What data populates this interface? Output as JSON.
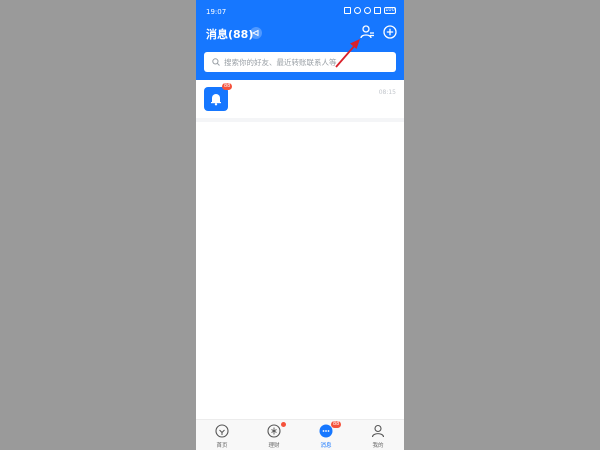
{
  "status_bar": {
    "time": "19:07",
    "battery": "100"
  },
  "header": {
    "title": "消息(88)"
  },
  "search": {
    "placeholder": "搜索你的好友、最近转账联系人等"
  },
  "messages": [
    {
      "badge": "88",
      "time": "08:15"
    }
  ],
  "tabbar": {
    "tabs": [
      {
        "label": "首页"
      },
      {
        "label": "理财"
      },
      {
        "label": "消息",
        "badge": "88"
      },
      {
        "label": "我的"
      }
    ]
  },
  "colors": {
    "brand": "#1677ff",
    "badge": "#f5523c",
    "annotation_arrow": "#d9202a"
  }
}
